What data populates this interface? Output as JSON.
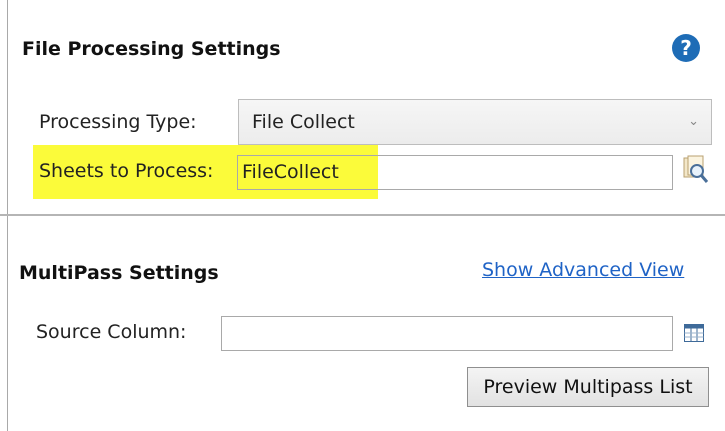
{
  "file_processing": {
    "title": "File Processing Settings",
    "help_icon": "help-icon",
    "help_glyph": "?",
    "processing_type": {
      "label": "Processing Type:",
      "value": "File Collect"
    },
    "sheets": {
      "label": "Sheets to Process:",
      "value": "FileCollect",
      "highlight_color": "#fbfb3a"
    },
    "browse_icon": "browse-sheets-icon"
  },
  "multipass": {
    "title": "MultiPass Settings",
    "advanced_link": "Show Advanced View",
    "source_column": {
      "label": "Source Column:",
      "value": ""
    },
    "column_icon": "column-picker-icon",
    "preview_button": "Preview Multipass List"
  },
  "colors": {
    "accent": "#1e6cb6",
    "link": "#1f63c6"
  }
}
